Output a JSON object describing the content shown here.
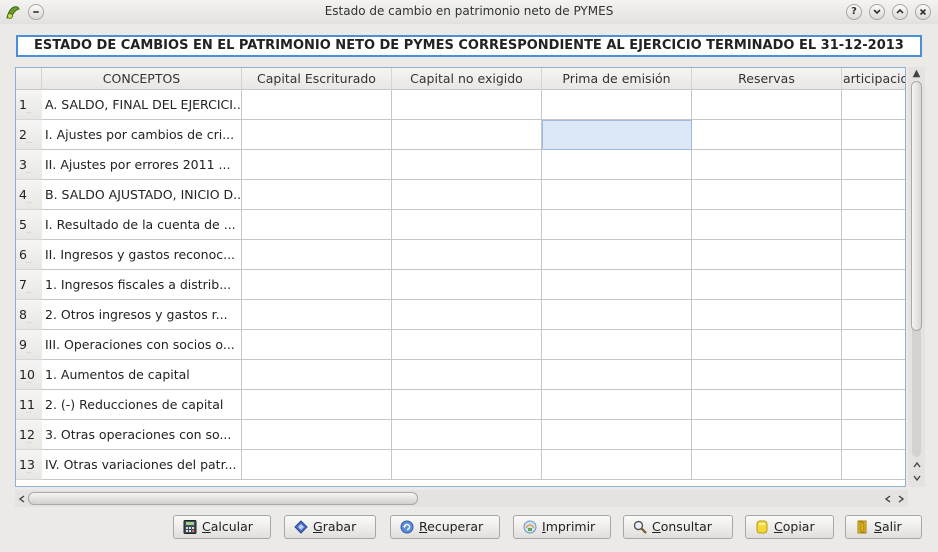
{
  "window": {
    "title": "Estado de cambio en patrimonio neto de PYMES"
  },
  "heading": "ESTADO DE CAMBIOS EN EL PATRIMONIO NETO DE PYMES CORRESPONDIENTE AL EJERCICIO TERMINADO EL 31-12-2013",
  "table": {
    "columns": [
      "CONCEPTOS",
      "Capital Escriturado",
      "Capital no exigido",
      "Prima de emisión",
      "Reservas",
      "articipacio"
    ],
    "rows": [
      {
        "num": "1",
        "concept": "A. SALDO, FINAL DEL EJERCICI..."
      },
      {
        "num": "2",
        "concept": "I. Ajustes por cambios de cri..."
      },
      {
        "num": "3",
        "concept": "II. Ajustes por errores 2011 ..."
      },
      {
        "num": "4",
        "concept": "B. SALDO AJUSTADO, INICIO D..."
      },
      {
        "num": "5",
        "concept": "I. Resultado de la cuenta de ..."
      },
      {
        "num": "6",
        "concept": "II. Ingresos y gastos reconoc..."
      },
      {
        "num": "7",
        "concept": "1. Ingresos fiscales a distrib..."
      },
      {
        "num": "8",
        "concept": "2. Otros ingresos y gastos r..."
      },
      {
        "num": "9",
        "concept": "III. Operaciones con socios o..."
      },
      {
        "num": "10",
        "concept": "1. Aumentos de capital"
      },
      {
        "num": "11",
        "concept": "2. (-) Reducciones de capital"
      },
      {
        "num": "12",
        "concept": "3. Otras operaciones con so..."
      },
      {
        "num": "13",
        "concept": "IV. Otras variaciones del patr..."
      }
    ]
  },
  "buttons": {
    "calcular": {
      "first": "C",
      "rest": "alcular",
      "icon": "calculator-icon"
    },
    "grabar": {
      "first": "G",
      "rest": "rabar",
      "icon": "save-icon"
    },
    "recuperar": {
      "first": "R",
      "rest": "ecuperar",
      "icon": "recover-icon"
    },
    "imprimir": {
      "first": "I",
      "rest": "mprimir",
      "icon": "print-icon"
    },
    "consultar": {
      "first": "C",
      "rest": "onsultar",
      "icon": "search-icon"
    },
    "copiar": {
      "first": "C",
      "rest": "opiar",
      "icon": "copy-icon"
    },
    "salir": {
      "first": "S",
      "rest": "alir",
      "icon": "exit-icon"
    }
  },
  "colors": {
    "accent": "#4a90d9",
    "selection": "#dde8f6"
  }
}
